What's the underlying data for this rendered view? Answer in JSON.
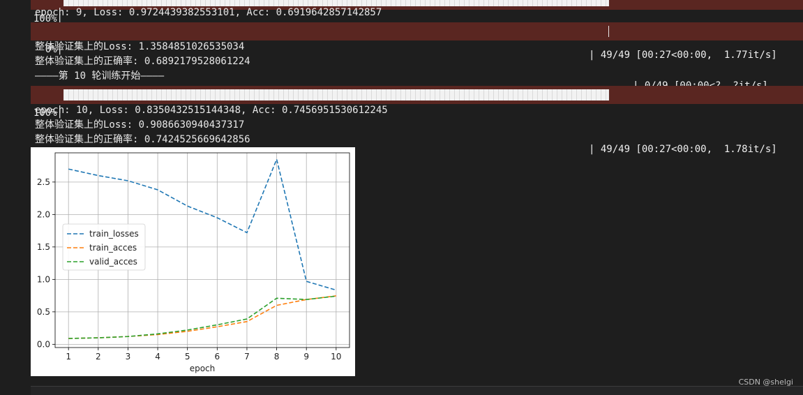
{
  "output": {
    "top_bar": {
      "percent": "100%|",
      "stats": "| 49/49 [00:27<00:00,  1.77it/s]",
      "progress": 1.0
    },
    "epoch9_line": "epoch: 9, Loss: 0.9724439382553101, Acc: 0.6919642857142857",
    "bar_a": {
      "percent": "0%|",
      "stats": "| 0/49 [00:00<?, ?it/s]",
      "progress": 0.0
    },
    "val_loss_9": "整体验证集上的Loss: 1.3584851026535034",
    "val_acc_9": "整体验证集上的正确率: 0.6892179528061224",
    "round_start": "————第 10 轮训练开始————",
    "bar_b": {
      "percent": "100%|",
      "stats": "| 49/49 [00:27<00:00,  1.78it/s]",
      "progress": 1.0
    },
    "epoch10_line": "epoch: 10, Loss: 0.8350432515144348, Acc: 0.7456951530612245",
    "val_loss_10": "整体验证集上的Loss: 0.9086630940437317",
    "val_acc_10": "整体验证集上的正确率: 0.7424525669642856"
  },
  "chart_data": {
    "type": "line",
    "xlabel": "epoch",
    "x": [
      1,
      2,
      3,
      4,
      5,
      6,
      7,
      8,
      9,
      10
    ],
    "xticks": [
      "1",
      "2",
      "3",
      "4",
      "5",
      "6",
      "7",
      "8",
      "9",
      "10"
    ],
    "yticks": [
      "0.0",
      "0.5",
      "1.0",
      "1.5",
      "2.0",
      "2.5"
    ],
    "xlim": [
      0.55,
      10.45
    ],
    "ylim": [
      -0.05,
      2.95
    ],
    "grid": true,
    "legend_position": "center-left",
    "series": [
      {
        "name": "train_losses",
        "color": "#1f77b4",
        "values": [
          2.7,
          2.6,
          2.52,
          2.38,
          2.13,
          1.95,
          1.72,
          2.85,
          0.97,
          0.835
        ]
      },
      {
        "name": "train_acces",
        "color": "#ff7f0e",
        "values": [
          0.09,
          0.1,
          0.12,
          0.15,
          0.2,
          0.27,
          0.35,
          0.6,
          0.69,
          0.746
        ]
      },
      {
        "name": "valid_acces",
        "color": "#2ca02c",
        "values": [
          0.09,
          0.1,
          0.12,
          0.16,
          0.22,
          0.3,
          0.39,
          0.71,
          0.69,
          0.742
        ]
      }
    ]
  },
  "watermark": "CSDN @shelgi"
}
